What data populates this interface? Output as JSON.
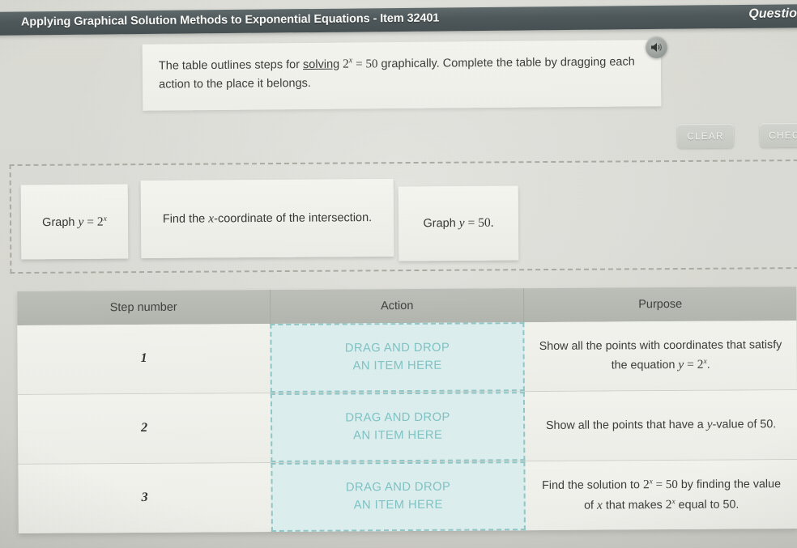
{
  "header": {
    "title": "Applying Graphical Solution Methods to Exponential Equations - Item 32401",
    "question_label": "Questio"
  },
  "instruction": {
    "line_a": "The table outlines steps for ",
    "underlined": "solving",
    "line_b": " graphically. Complete the table by dragging each action to the place it belongs.",
    "equation_base": "2",
    "equation_exp": "x",
    "equation_rhs": "= 50",
    "audio_icon": "speaker-icon"
  },
  "toolbar": {
    "clear_label": "CLEAR",
    "check_label": "CHECK"
  },
  "bank": {
    "tiles": [
      {
        "prefix": "Graph ",
        "var": "y",
        "op": " = 2",
        "exp": "x",
        "suffix": ""
      },
      {
        "prefix": "Find the ",
        "var": "x",
        "op": "-coordinate of the intersection.",
        "exp": "",
        "suffix": ""
      },
      {
        "prefix": "Graph ",
        "var": "y",
        "op": " = 50.",
        "exp": "",
        "suffix": ""
      }
    ],
    "tile_1_text": "Graph y = 2^x",
    "tile_2_text": "Find the x-coordinate of the intersection.",
    "tile_3_text": "Graph y = 50."
  },
  "table": {
    "headers": {
      "step": "Step number",
      "action": "Action",
      "purpose": "Purpose"
    },
    "dropzone_line1": "DRAG AND DROP",
    "dropzone_line2": "AN ITEM HERE",
    "rows": [
      {
        "step": "1",
        "action": "DRAG AND DROP AN ITEM HERE",
        "purpose_a": "Show all the points with coordinates that satisfy the equation ",
        "purpose_var": "y",
        "purpose_b": " = 2",
        "purpose_exp": "x",
        "purpose_c": "."
      },
      {
        "step": "2",
        "action": "DRAG AND DROP AN ITEM HERE",
        "purpose_a": "Show all the points that have a ",
        "purpose_var": "y",
        "purpose_b": "-value of 50.",
        "purpose_exp": "",
        "purpose_c": ""
      },
      {
        "step": "3",
        "action": "DRAG AND DROP AN ITEM HERE",
        "purpose_a": "Find the solution to ",
        "purpose_var": "",
        "purpose_b": "2",
        "purpose_exp": "x",
        "purpose_c": " = 50 by finding the value of x that makes 2^x equal to 50."
      }
    ]
  },
  "colors": {
    "header_bar": "#4c5659",
    "dropzone_fill": "#dcefee",
    "dropzone_border": "#8fc6c6",
    "dropzone_text": "#7ec2c4",
    "table_header": "#b2b5ae",
    "page_background": "#d9d9d3"
  }
}
